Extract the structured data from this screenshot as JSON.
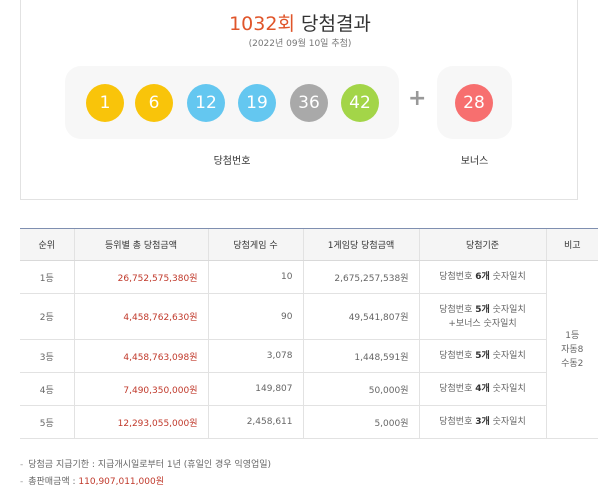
{
  "header": {
    "round": "1032회",
    "title_suffix": "당첨결과",
    "date": "(2022년 09월 10일 추첨)"
  },
  "winning_numbers": [
    {
      "value": "1",
      "color": "#f9c40a"
    },
    {
      "value": "6",
      "color": "#f9c40a"
    },
    {
      "value": "12",
      "color": "#64c7f0"
    },
    {
      "value": "19",
      "color": "#64c7f0"
    },
    {
      "value": "36",
      "color": "#a9a9a9"
    },
    {
      "value": "42",
      "color": "#a3d548"
    }
  ],
  "bonus_number": {
    "value": "28",
    "color": "#f76f6f"
  },
  "plus_sign": "+",
  "labels": {
    "winning": "당첨번호",
    "bonus": "보너스"
  },
  "table": {
    "headers": [
      "순위",
      "등위별 총 당첨금액",
      "당첨게임 수",
      "1게임당 당첨금액",
      "당첨기준",
      "비고"
    ],
    "rows": [
      {
        "rank": "1등",
        "total": "26,752,575,380원",
        "count": "10",
        "per": "2,675,257,538원",
        "crit_pre": "당첨번호 ",
        "crit_num": "6개",
        "crit_post": " 숫자일치",
        "crit_extra": ""
      },
      {
        "rank": "2등",
        "total": "4,458,762,630원",
        "count": "90",
        "per": "49,541,807원",
        "crit_pre": "당첨번호 ",
        "crit_num": "5개",
        "crit_post": " 숫자일치",
        "crit_extra": "+보너스 숫자일치"
      },
      {
        "rank": "3등",
        "total": "4,458,763,098원",
        "count": "3,078",
        "per": "1,448,591원",
        "crit_pre": "당첨번호 ",
        "crit_num": "5개",
        "crit_post": " 숫자일치",
        "crit_extra": ""
      },
      {
        "rank": "4등",
        "total": "7,490,350,000원",
        "count": "149,807",
        "per": "50,000원",
        "crit_pre": "당첨번호 ",
        "crit_num": "4개",
        "crit_post": " 숫자일치",
        "crit_extra": ""
      },
      {
        "rank": "5등",
        "total": "12,293,055,000원",
        "count": "2,458,611",
        "per": "5,000원",
        "crit_pre": "당첨번호 ",
        "crit_num": "3개",
        "crit_post": " 숫자일치",
        "crit_extra": ""
      }
    ],
    "note": {
      "line1": "1등",
      "line2": "자동8",
      "line3": "수동2"
    }
  },
  "footnotes": {
    "deadline": "당첨금 지급기한 : 지급개시일로부터 1년 (휴일인 경우 익영업일)",
    "sales_label": "총판매금액 : ",
    "sales_amount": "110,907,011,000원",
    "dash": "-"
  }
}
